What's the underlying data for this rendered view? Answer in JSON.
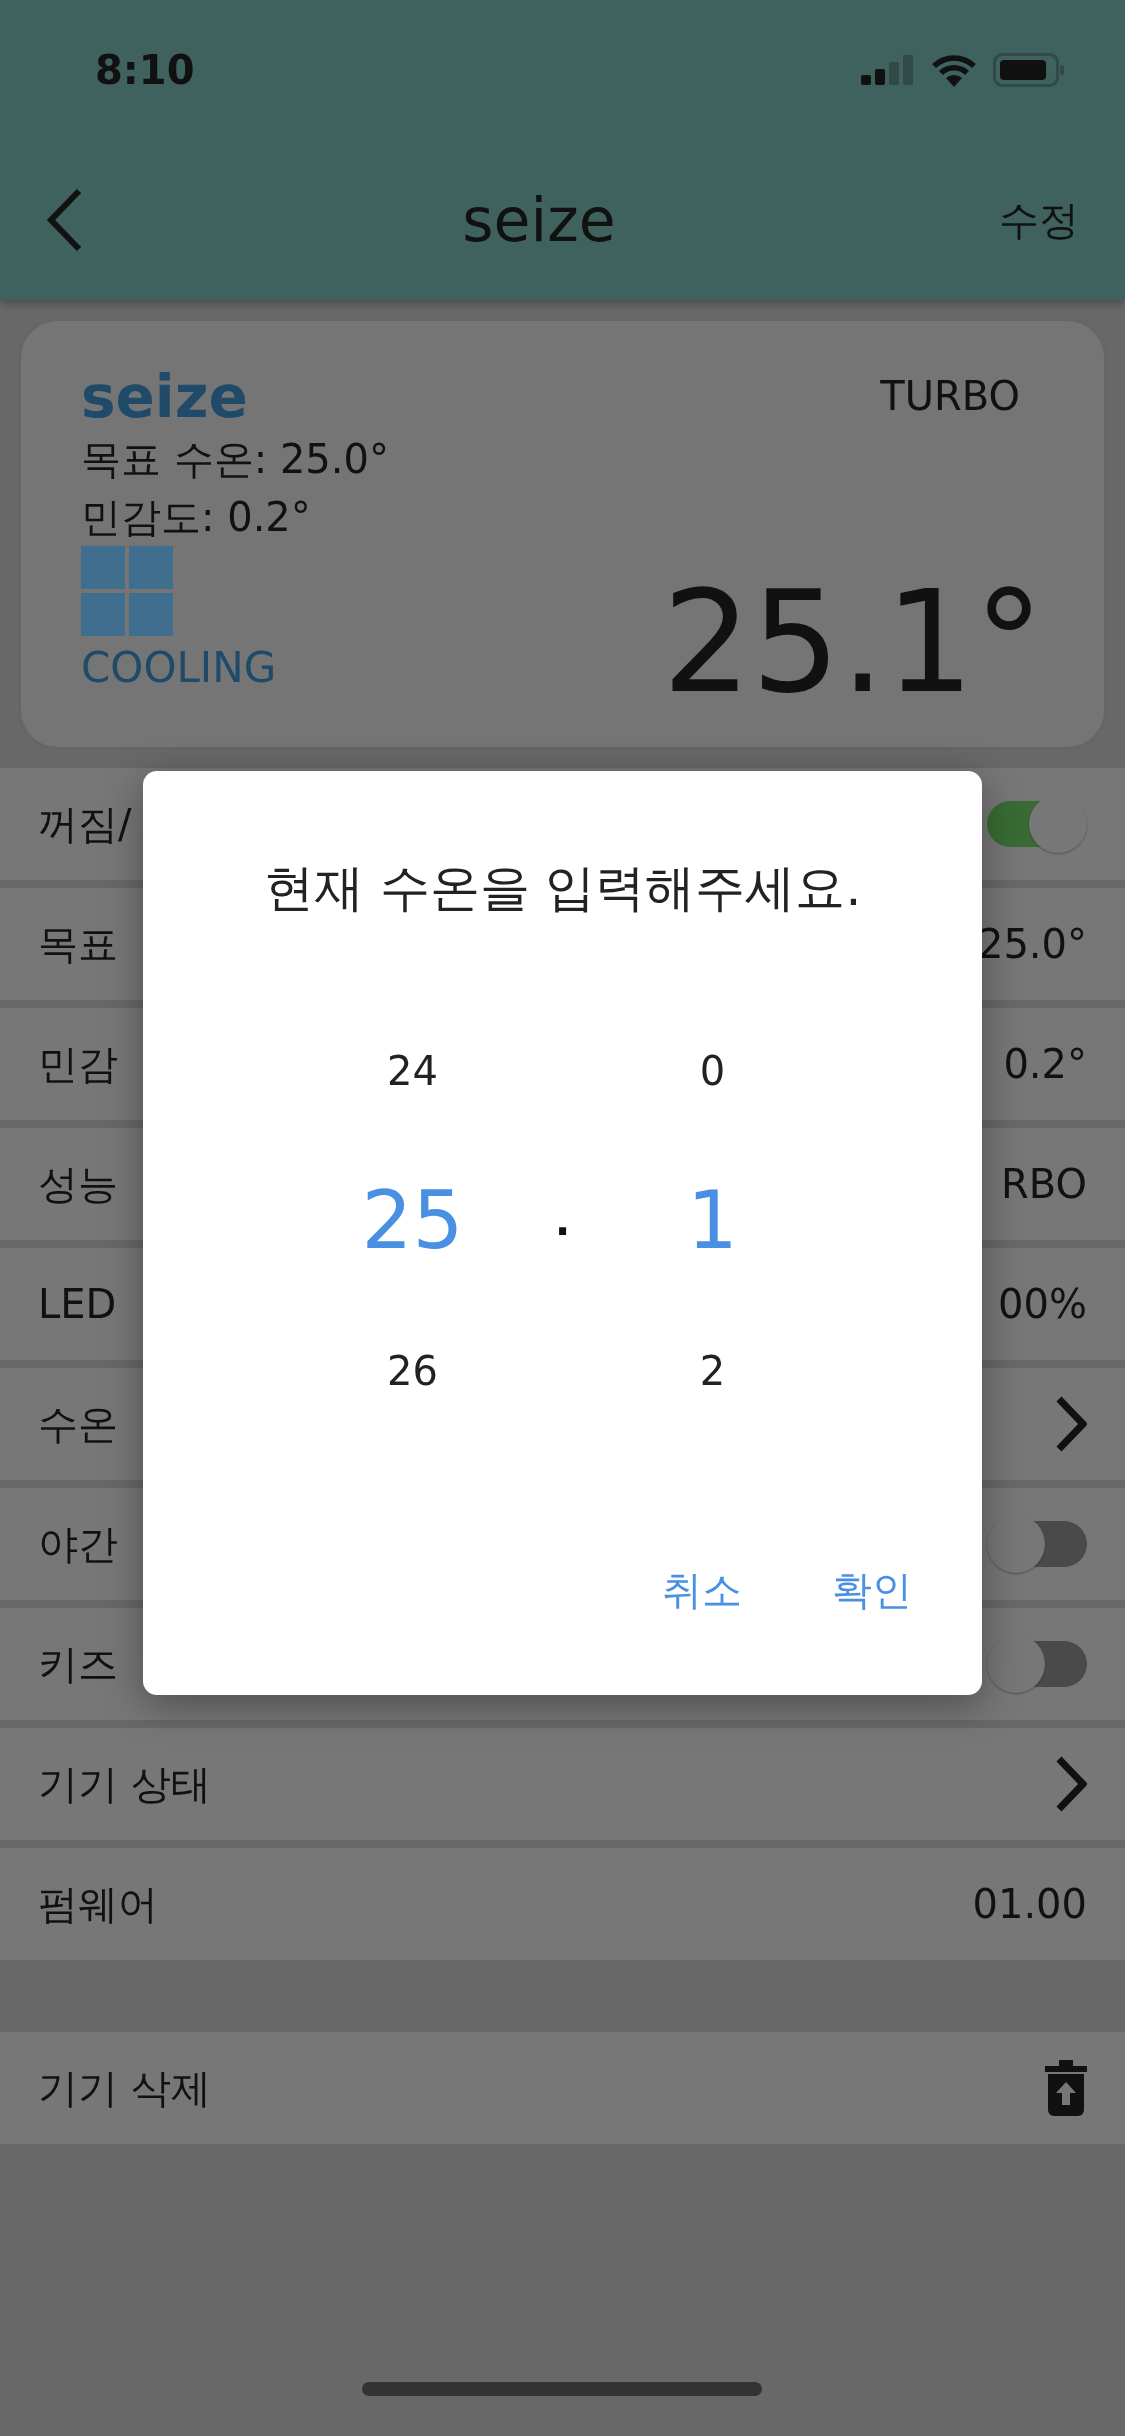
{
  "status_bar": {
    "time": "8:10"
  },
  "header": {
    "title": "seize",
    "action": "수정"
  },
  "device_card": {
    "name": "seize",
    "target_line": "목표 수온: 25.0°",
    "sensitivity_line": "민감도: 0.2°",
    "mode": "COOLING",
    "performance": "TURBO",
    "current_temp": "25.1°"
  },
  "settings": [
    {
      "kind": "toggle",
      "label": "꺼짐/",
      "on": true
    },
    {
      "kind": "value",
      "label": "목표",
      "value": "25.0°"
    },
    {
      "kind": "value",
      "label": "민감",
      "value": "0.2°"
    },
    {
      "kind": "value",
      "label": "성능",
      "value": "RBO"
    },
    {
      "kind": "value",
      "label": "LED",
      "value": "00%"
    },
    {
      "kind": "chevron",
      "label": "수온"
    },
    {
      "kind": "toggle",
      "label": "야간",
      "on": false
    },
    {
      "kind": "toggle",
      "label": "키즈",
      "on": false
    },
    {
      "kind": "chevron",
      "label": "기기 상태"
    },
    {
      "kind": "value",
      "label": "펌웨어",
      "value": "01.00"
    }
  ],
  "delete_row": {
    "label": "기기 삭제"
  },
  "dialog": {
    "title": "현재 수온을 입력해주세요.",
    "separator": ".",
    "columns": [
      {
        "items": [
          {
            "value": "24",
            "selected": false
          },
          {
            "value": "25",
            "selected": true
          },
          {
            "value": "26",
            "selected": false
          }
        ]
      },
      {
        "items": [
          {
            "value": "0",
            "selected": false
          },
          {
            "value": "1",
            "selected": true
          },
          {
            "value": "2",
            "selected": false
          }
        ]
      }
    ],
    "buttons": [
      "취소",
      "확인"
    ]
  }
}
